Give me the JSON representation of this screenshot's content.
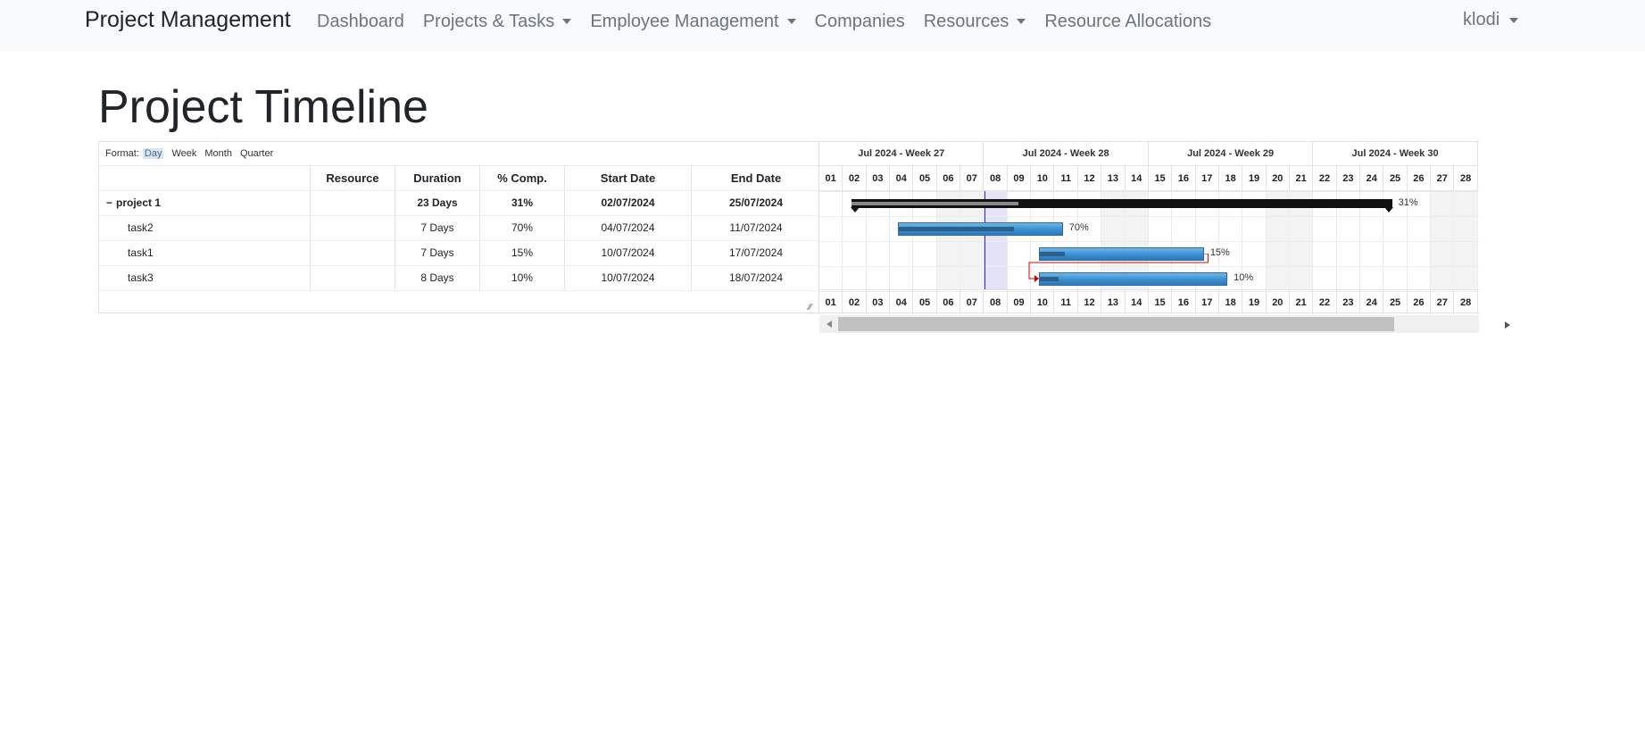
{
  "navbar": {
    "brand": "Project Management",
    "items": [
      {
        "label": "Dashboard",
        "dropdown": false
      },
      {
        "label": "Projects & Tasks",
        "dropdown": true
      },
      {
        "label": "Employee Management",
        "dropdown": true
      },
      {
        "label": "Companies",
        "dropdown": false
      },
      {
        "label": "Resources",
        "dropdown": true
      },
      {
        "label": "Resource Allocations",
        "dropdown": false
      }
    ],
    "user": "klodi"
  },
  "page": {
    "title": "Project Timeline"
  },
  "gantt": {
    "format_label": "Format:",
    "formats": [
      "Day",
      "Week",
      "Month",
      "Quarter"
    ],
    "active_format": "Day",
    "columns": [
      "",
      "Resource",
      "Duration",
      "% Comp.",
      "Start Date",
      "End Date"
    ],
    "rows": [
      {
        "name": "project 1",
        "toggle": "−",
        "resource": "",
        "duration": "23 Days",
        "pct": "31%",
        "start": "02/07/2024",
        "end": "25/07/2024",
        "group": true
      },
      {
        "name": "task2",
        "resource": "",
        "duration": "7 Days",
        "pct": "70%",
        "start": "04/07/2024",
        "end": "11/07/2024",
        "group": false
      },
      {
        "name": "task1",
        "resource": "",
        "duration": "7 Days",
        "pct": "15%",
        "start": "10/07/2024",
        "end": "17/07/2024",
        "group": false
      },
      {
        "name": "task3",
        "resource": "",
        "duration": "8 Days",
        "pct": "10%",
        "start": "10/07/2024",
        "end": "18/07/2024",
        "group": false
      }
    ],
    "weeks": [
      "Jul 2024 - Week 27",
      "Jul 2024 - Week 28",
      "Jul 2024 - Week 29",
      "Jul 2024 - Week 30"
    ],
    "days": [
      "01",
      "02",
      "03",
      "04",
      "05",
      "06",
      "07",
      "08",
      "09",
      "10",
      "11",
      "12",
      "13",
      "14",
      "15",
      "16",
      "17",
      "18",
      "19",
      "20",
      "21",
      "22",
      "23",
      "24",
      "25",
      "26",
      "27",
      "28"
    ],
    "weekend_days": [
      "06",
      "07",
      "13",
      "14",
      "20",
      "21",
      "27",
      "28"
    ],
    "today": "08",
    "colors": {
      "group_bar": "#111111",
      "task_bar": "#3a8fd0",
      "today_line": "#2c2cb0",
      "dependency": "#d9000d"
    }
  },
  "chart_data": {
    "type": "gantt",
    "tasks": [
      {
        "name": "project 1",
        "start": "2024-07-02",
        "end": "2024-07-25",
        "progress": 31,
        "label": "31%"
      },
      {
        "name": "task2",
        "start": "2024-07-04",
        "end": "2024-07-11",
        "progress": 70,
        "label": "70%"
      },
      {
        "name": "task1",
        "start": "2024-07-10",
        "end": "2024-07-17",
        "progress": 15,
        "label": "15%"
      },
      {
        "name": "task3",
        "start": "2024-07-10",
        "end": "2024-07-18",
        "progress": 10,
        "label": "10%"
      }
    ],
    "dependencies": [
      {
        "from": "task1",
        "to": "task3"
      }
    ]
  }
}
